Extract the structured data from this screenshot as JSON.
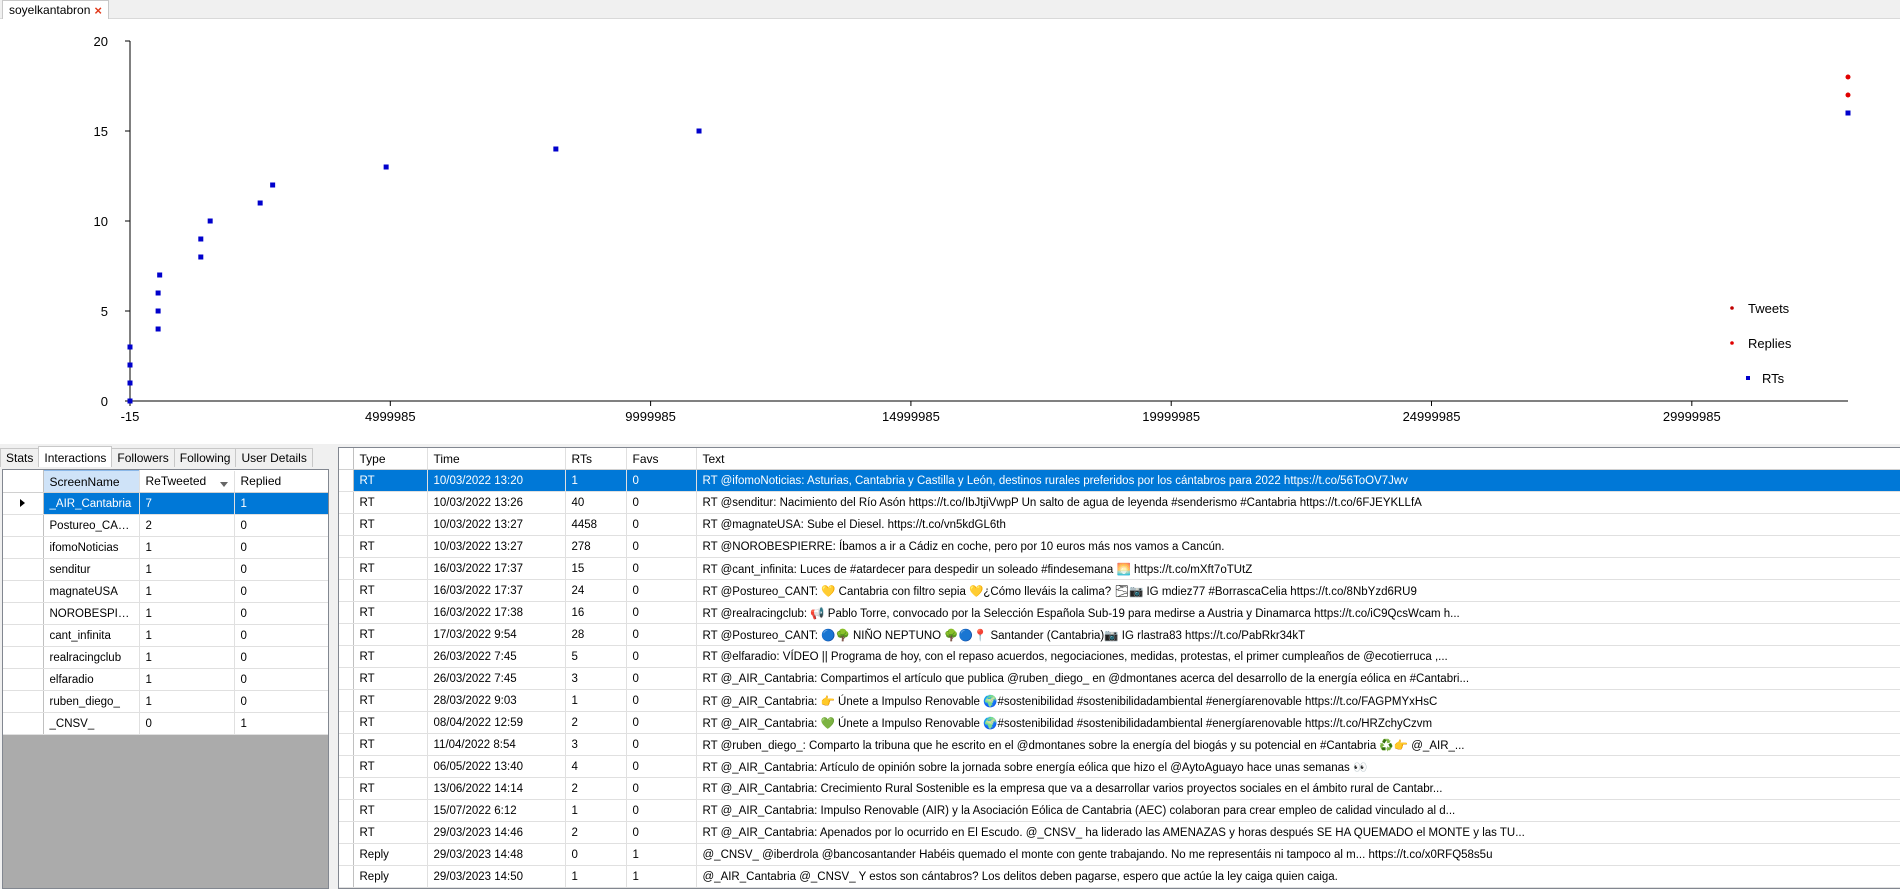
{
  "window_tab": {
    "title": "soyelkantabron",
    "close": "×"
  },
  "chart_data": {
    "type": "scatter",
    "title": "",
    "xlabel": "",
    "ylabel": "",
    "xlim": [
      -15,
      33000000
    ],
    "ylim": [
      0,
      20
    ],
    "x_ticks": [
      "-15",
      "4999985",
      "9999985",
      "14999985",
      "19999985",
      "24999985",
      "29999985"
    ],
    "x_tick_values": [
      -15,
      4999985,
      9999985,
      14999985,
      19999985,
      24999985,
      29999985
    ],
    "y_ticks": [
      "0",
      "5",
      "10",
      "15",
      "20"
    ],
    "y_tick_values": [
      0,
      5,
      10,
      15,
      20
    ],
    "grid": false,
    "legend_position": "right",
    "series": [
      {
        "name": "Tweets",
        "color": "#c00000",
        "marker": "circle",
        "points": []
      },
      {
        "name": "Replies",
        "color": "#e00000",
        "marker": "circle",
        "points": [
          [
            33000000,
            17
          ],
          [
            33000000,
            18
          ]
        ]
      },
      {
        "name": "RTs",
        "color": "#0000cc",
        "marker": "square",
        "points": [
          [
            0,
            0
          ],
          [
            0,
            1
          ],
          [
            0,
            2
          ],
          [
            0,
            3
          ],
          [
            540000,
            4
          ],
          [
            540000,
            5
          ],
          [
            540000,
            6
          ],
          [
            570000,
            7
          ],
          [
            1360000,
            8
          ],
          [
            1360000,
            9
          ],
          [
            1540000,
            10
          ],
          [
            2500000,
            11
          ],
          [
            2740000,
            12
          ],
          [
            4920000,
            13
          ],
          [
            8180000,
            14
          ],
          [
            10930000,
            15
          ],
          [
            33000000,
            16
          ]
        ]
      }
    ]
  },
  "left_tabs": [
    {
      "label": "Stats",
      "active": false
    },
    {
      "label": "Interactions",
      "active": true
    },
    {
      "label": "Followers",
      "active": false
    },
    {
      "label": "Following",
      "active": false
    },
    {
      "label": "User Details",
      "active": false
    }
  ],
  "interactions": {
    "columns": [
      "ScreenName",
      "ReTweeted",
      "Replied"
    ],
    "rows": [
      [
        "_AIR_Cantabria",
        "7",
        "1"
      ],
      [
        "Postureo_CANT",
        "2",
        "0"
      ],
      [
        "ifomoNoticias",
        "1",
        "0"
      ],
      [
        "senditur",
        "1",
        "0"
      ],
      [
        "magnateUSA",
        "1",
        "0"
      ],
      [
        "NOROBESPIE...",
        "1",
        "0"
      ],
      [
        "cant_infinita",
        "1",
        "0"
      ],
      [
        "realracingclub",
        "1",
        "0"
      ],
      [
        "elfaradio",
        "1",
        "0"
      ],
      [
        "ruben_diego_",
        "1",
        "0"
      ],
      [
        "_CNSV_",
        "0",
        "1"
      ]
    ]
  },
  "tweets": {
    "columns": [
      "Type",
      "Time",
      "RTs",
      "Favs",
      "Text"
    ],
    "rows": [
      [
        "RT",
        "10/03/2022 13:20",
        "1",
        "0",
        "RT @ifomoNoticias: Asturias, Cantabria y Castilla y León, destinos rurales preferidos por los cántabros para 2022 https://t.co/56ToOV7Jwv"
      ],
      [
        "RT",
        "10/03/2022 13:26",
        "40",
        "0",
        "RT @senditur: Nacimiento del Río Asón  https://t.co/IbJtjiVwpP Un salto de agua de leyenda #senderismo #Cantabria https://t.co/6FJEYKLLfA"
      ],
      [
        "RT",
        "10/03/2022 13:27",
        "4458",
        "0",
        "RT @magnateUSA: Sube el Diesel. https://t.co/vn5kdGL6th"
      ],
      [
        "RT",
        "10/03/2022 13:27",
        "278",
        "0",
        "RT @NOROBESPIERRE: Íbamos a ir a Cádiz en coche, pero por 10 euros más nos vamos a Cancún."
      ],
      [
        "RT",
        "16/03/2022 17:37",
        "15",
        "0",
        "RT @cant_infinita: Luces de #atardecer para despedir un soleado #findesemana 🌅 https://t.co/mXft7oTUtZ"
      ],
      [
        "RT",
        "16/03/2022 17:37",
        "24",
        "0",
        "RT @Postureo_CANT: 💛 Cantabria con filtro sepia 💛¿Cómo lleváis la calima? 🌫📷 IG mdiez77 #BorrascaCelia https://t.co/8NbYzd6RU9"
      ],
      [
        "RT",
        "16/03/2022 17:38",
        "16",
        "0",
        "RT @realracingclub: 📢 Pablo Torre, convocado por la Selección Española Sub-19 para medirse a Austria y Dinamarca https://t.co/iC9QcsWcam h..."
      ],
      [
        "RT",
        "17/03/2022 9:54",
        "28",
        "0",
        "RT @Postureo_CANT: 🔵🌳 NIÑO NEPTUNO 🌳🔵📍 Santander (Cantabria)📷 IG rlastra83 https://t.co/PabRkr34kT"
      ],
      [
        "RT",
        "26/03/2022 7:45",
        "5",
        "0",
        "RT @elfaradio: VÍDEO || Programa de hoy, con el repaso acuerdos, negociaciones, medidas, protestas, el primer cumpleaños de @ecotierruca ,..."
      ],
      [
        "RT",
        "26/03/2022 7:45",
        "3",
        "0",
        "RT @_AIR_Cantabria: Compartimos el artículo que publica @ruben_diego_ en @dmontanes acerca del desarrollo de la energía eólica en #Cantabri..."
      ],
      [
        "RT",
        "28/03/2022 9:03",
        "1",
        "0",
        "RT @_AIR_Cantabria: 👉 Únete a Impulso Renovable 🌍#sostenibilidad #sostenibilidadambiental #energíarenovable https://t.co/FAGPMYxHsC"
      ],
      [
        "RT",
        "08/04/2022 12:59",
        "2",
        "0",
        "RT @_AIR_Cantabria: 💚 Únete a Impulso Renovable 🌍#sostenibilidad #sostenibilidadambiental #energíarenovable https://t.co/HRZchyCzvm"
      ],
      [
        "RT",
        "11/04/2022 8:54",
        "3",
        "0",
        "RT @ruben_diego_: Comparto la tribuna que he escrito en el @dmontanes sobre la energía del biogás y su potencial en #Cantabria ♻️👉 @_AIR_..."
      ],
      [
        "RT",
        "06/05/2022 13:40",
        "4",
        "0",
        "RT @_AIR_Cantabria: Artículo de opinión sobre la jornada sobre energía eólica que hizo el @AytoAguayo hace unas semanas 👀"
      ],
      [
        "RT",
        "13/06/2022 14:14",
        "2",
        "0",
        "RT @_AIR_Cantabria: Crecimiento Rural Sostenible es la empresa que va a desarrollar varios proyectos sociales en el ámbito rural de Cantabr..."
      ],
      [
        "RT",
        "15/07/2022 6:12",
        "1",
        "0",
        "RT @_AIR_Cantabria: Impulso Renovable (AIR) y la Asociación Eólica de Cantabria (AEC) colaboran para crear empleo de calidad vinculado al d..."
      ],
      [
        "RT",
        "29/03/2023 14:46",
        "2",
        "0",
        "RT @_AIR_Cantabria: Apenados por lo ocurrido en El Escudo. @_CNSV_ ha liderado las AMENAZAS y horas después SE HA QUEMADO el MONTE y las TU..."
      ],
      [
        "Reply",
        "29/03/2023 14:48",
        "0",
        "1",
        "@_CNSV_ @iberdrola @bancosantander Habéis quemado el monte con gente trabajando. No me representáis ni tampoco al m... https://t.co/x0RFQ58s5u"
      ],
      [
        "Reply",
        "29/03/2023 14:50",
        "1",
        "1",
        "@_AIR_Cantabria @_CNSV_ Y estos son cántabros? Los delitos deben pagarse, espero que actúe la ley caiga quien caiga."
      ]
    ]
  }
}
